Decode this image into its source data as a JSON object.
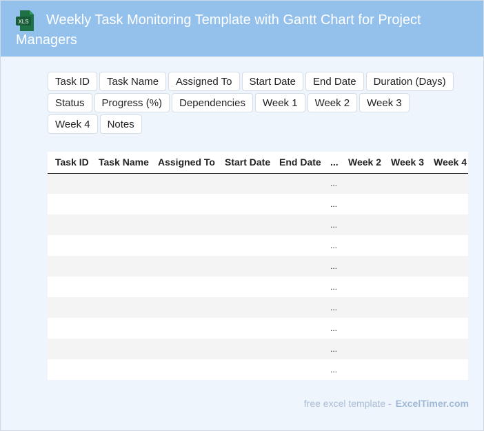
{
  "header": {
    "title": "Weekly Task Monitoring Template with Gantt Chart for Project Managers",
    "icon_label": "XLS",
    "icon_name": "excel-file-icon"
  },
  "chips": [
    "Task ID",
    "Task Name",
    "Assigned To",
    "Start Date",
    "End Date",
    "Duration (Days)",
    "Status",
    "Progress (%)",
    "Dependencies",
    "Week 1",
    "Week 2",
    "Week 3",
    "Week 4",
    "Notes"
  ],
  "table": {
    "columns": [
      "Task ID",
      "Task Name",
      "Assigned To",
      "Start Date",
      "End Date",
      "...",
      "Week 2",
      "Week 3",
      "Week 4"
    ],
    "rows": [
      [
        "",
        "",
        "",
        "",
        "",
        "...",
        "",
        "",
        ""
      ],
      [
        "",
        "",
        "",
        "",
        "",
        "...",
        "",
        "",
        ""
      ],
      [
        "",
        "",
        "",
        "",
        "",
        "...",
        "",
        "",
        ""
      ],
      [
        "",
        "",
        "",
        "",
        "",
        "...",
        "",
        "",
        ""
      ],
      [
        "",
        "",
        "",
        "",
        "",
        "...",
        "",
        "",
        ""
      ],
      [
        "",
        "",
        "",
        "",
        "",
        "...",
        "",
        "",
        ""
      ],
      [
        "",
        "",
        "",
        "",
        "",
        "...",
        "",
        "",
        ""
      ],
      [
        "",
        "",
        "",
        "",
        "",
        "...",
        "",
        "",
        ""
      ],
      [
        "",
        "",
        "",
        "",
        "",
        "...",
        "",
        "",
        ""
      ],
      [
        "",
        "",
        "",
        "",
        "",
        "...",
        "",
        "",
        ""
      ]
    ]
  },
  "footer": {
    "text": "free excel template -",
    "brand": "ExcelTimer.com"
  },
  "colors": {
    "header_bg": "#94c1ec",
    "page_bg": "#eef5fd",
    "icon_green": "#1e7145"
  }
}
